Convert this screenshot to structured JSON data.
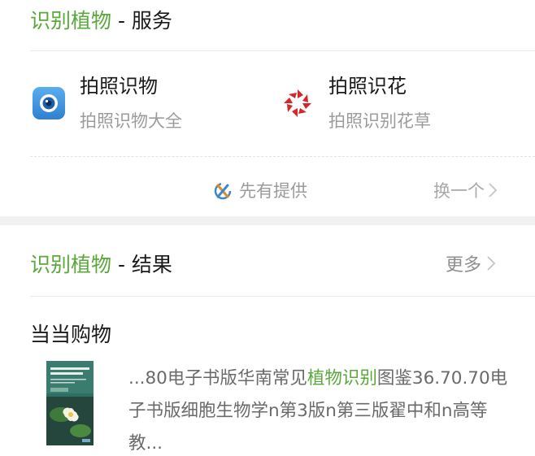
{
  "services_card": {
    "title_highlight": "识别植物",
    "title_rest": " - 服务",
    "services": [
      {
        "icon": "camera-eye-icon",
        "title": "拍照识物",
        "subtitle": "拍照识物大全",
        "accent": "#3b8fd8"
      },
      {
        "icon": "red-aperture-icon",
        "title": "拍照识花",
        "subtitle": "拍照识别花草",
        "accent": "#d7262b"
      }
    ],
    "provider": {
      "icon": "provider-logo-icon",
      "label": "先有提供"
    },
    "swap_label": "换一个"
  },
  "results_card": {
    "title_highlight": "识别植物",
    "title_rest": " - 结果",
    "more_label": "更多",
    "source_name": "当当购物",
    "result": {
      "thumbnail_icon": "book-cover-thumbnail",
      "snippet_before": "...80电子书版华南常见",
      "snippet_highlight": "植物识别",
      "snippet_after": "图鉴36.70.70电子书版细胞生物学n第3版n第三版翟中和n高等教..."
    }
  },
  "colors": {
    "highlight_green": "#5aa83c",
    "primary_text": "#1a1a1a",
    "secondary_text": "#9b9b9b"
  }
}
